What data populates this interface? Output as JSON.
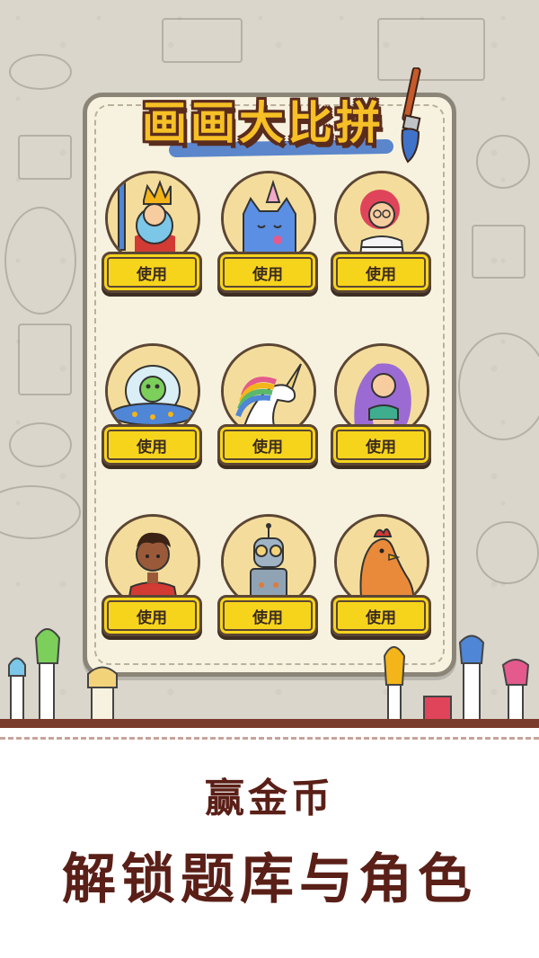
{
  "header": {
    "title": "画画大比拼",
    "brush_icon": "paintbrush-icon"
  },
  "characters": [
    {
      "name": "king",
      "icon": "king-character-icon",
      "button_label": "使用"
    },
    {
      "name": "party-cat",
      "icon": "party-cat-character-icon",
      "button_label": "使用"
    },
    {
      "name": "artist-girl",
      "icon": "artist-girl-character-icon",
      "button_label": "使用"
    },
    {
      "name": "alien",
      "icon": "alien-ufo-character-icon",
      "button_label": "使用"
    },
    {
      "name": "unicorn",
      "icon": "unicorn-character-icon",
      "button_label": "使用"
    },
    {
      "name": "mermaid",
      "icon": "mermaid-character-icon",
      "button_label": "使用"
    },
    {
      "name": "boy",
      "icon": "boy-character-icon",
      "button_label": "使用"
    },
    {
      "name": "robot",
      "icon": "robot-character-icon",
      "button_label": "使用"
    },
    {
      "name": "chicken",
      "icon": "chicken-character-icon",
      "button_label": "使用"
    }
  ],
  "promo": {
    "line1": "赢金币",
    "line2": "解锁题库与角色"
  },
  "colors": {
    "button_yellow": "#f7d41c",
    "portrait_bg": "#f4dd9c",
    "promo_text": "#5a1f17",
    "board_bg": "#f7f2df"
  }
}
